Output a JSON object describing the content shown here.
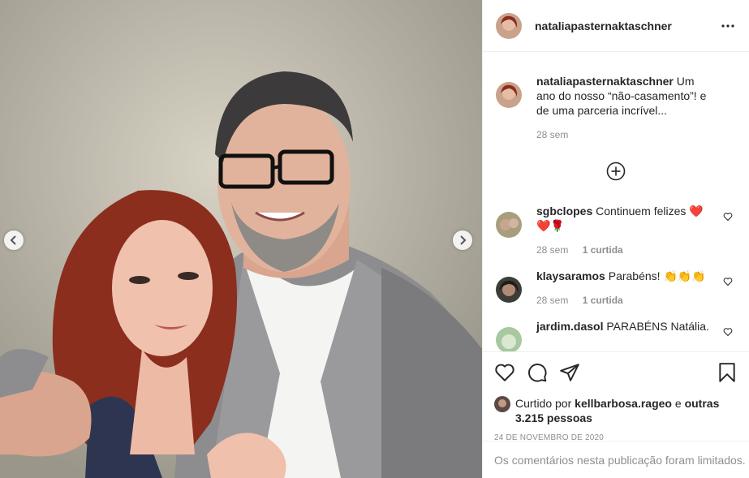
{
  "post": {
    "username": "nataliapasternaktaschner",
    "caption": {
      "username": "nataliapasternaktaschner",
      "text": "Um ano do nosso “não-casamento”! e de uma parceria incrível...",
      "time": "28 sem"
    },
    "comments": [
      {
        "username": "sgbclopes",
        "text": "Continuem felizes ❤️ ❤️🌹",
        "time": "28 sem",
        "likes": "1 curtida"
      },
      {
        "username": "klaysaramos",
        "text": "Parabéns! 👏👏👏",
        "time": "28 sem",
        "likes": "1 curtida"
      },
      {
        "username": "jardim.dasol",
        "text": "PARABÉNS Natália.",
        "time": "",
        "likes": ""
      }
    ],
    "liked_by": {
      "prefix": "Curtido por",
      "user": "kellbarbosa.rageo",
      "conjunction": "e",
      "others": "outras 3.215 pessoas"
    },
    "date": "24 DE NOVEMBRO DE 2020",
    "comments_limited": "Os comentários nesta publicação foram limitados."
  },
  "icons": {
    "more": "more-options-icon",
    "load_more": "plus-circle-icon",
    "like": "heart-icon",
    "comment": "comment-icon",
    "share": "share-icon",
    "save": "bookmark-icon",
    "prev": "chevron-left-icon",
    "next": "chevron-right-icon"
  },
  "colors": {
    "text": "#262626",
    "secondary": "#8e8e8e",
    "border": "#efefef"
  }
}
